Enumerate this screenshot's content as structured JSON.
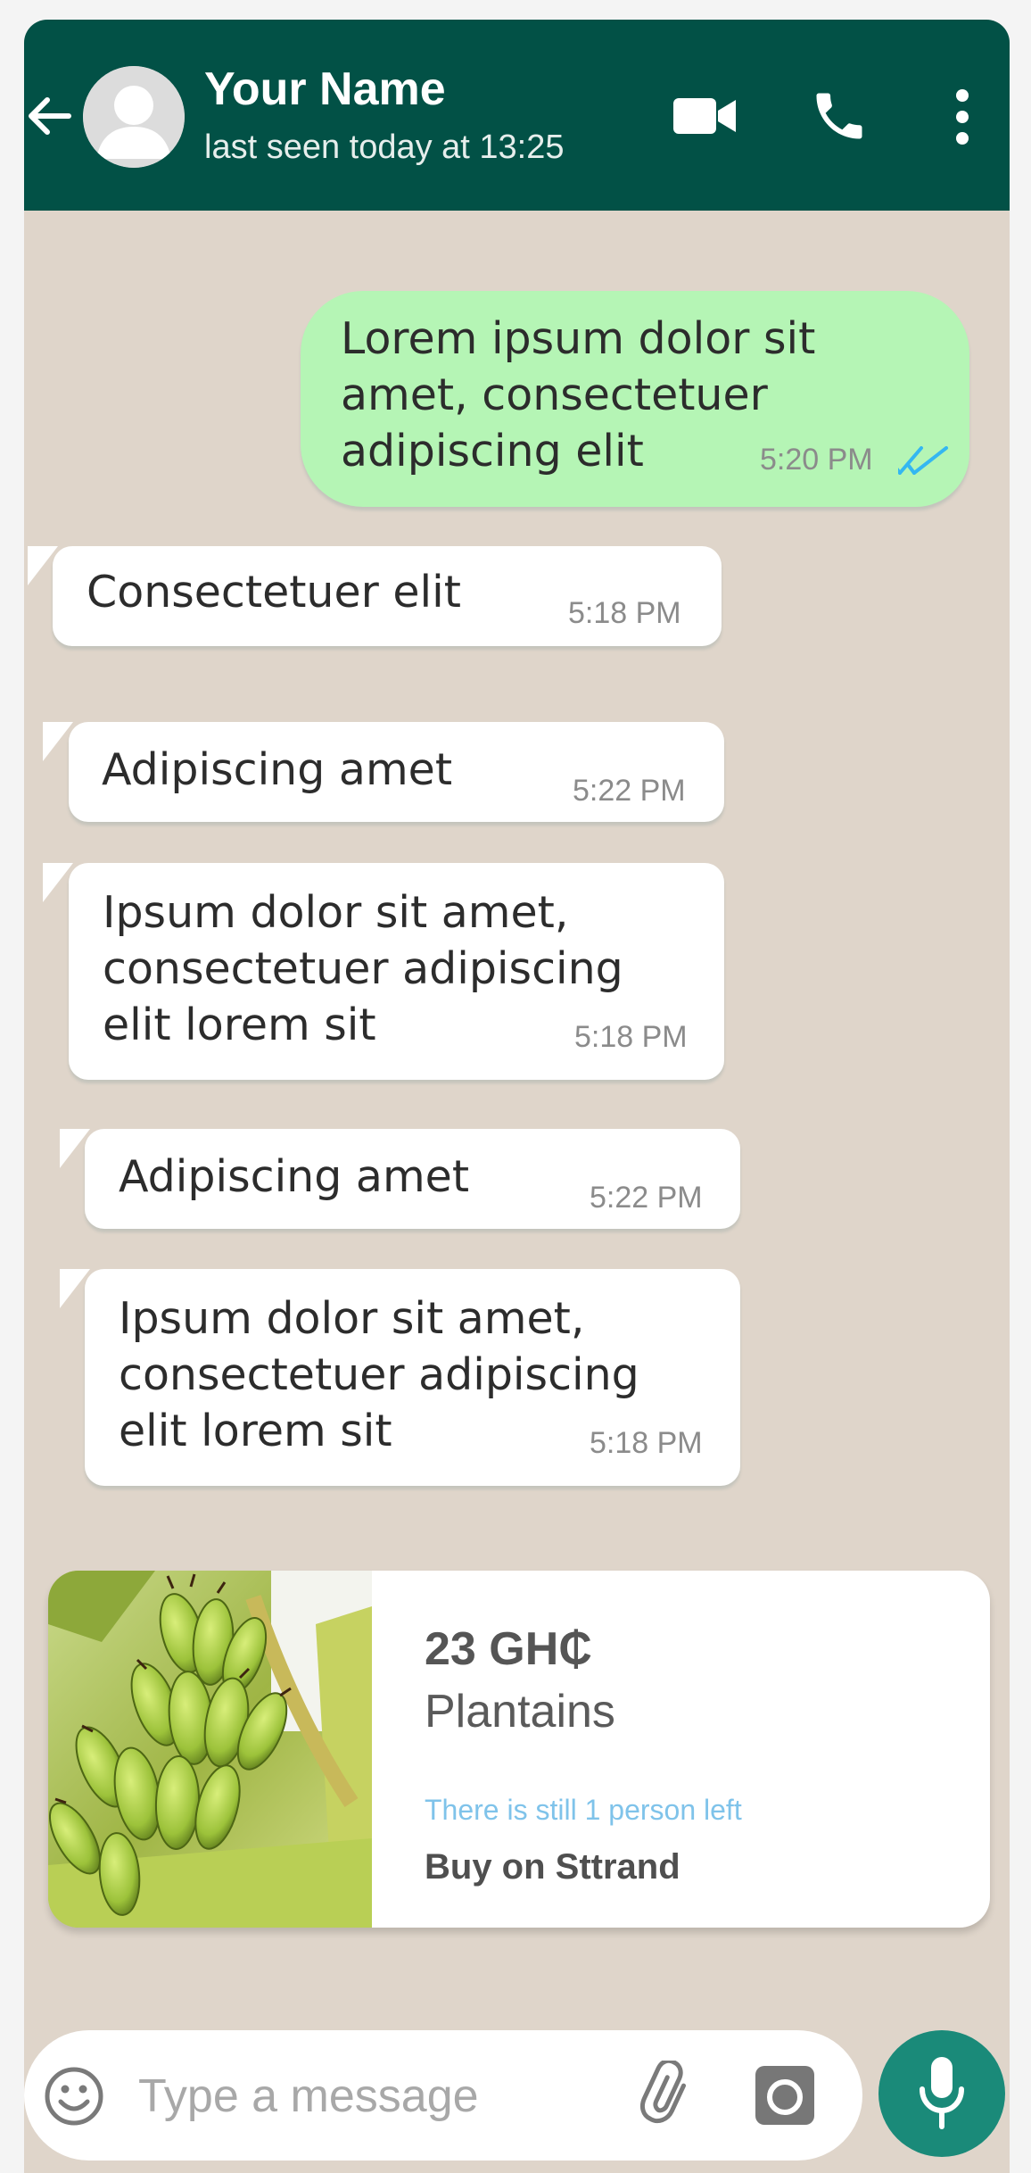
{
  "header": {
    "contact_name": "Your Name",
    "last_seen": "last seen today at 13:25",
    "icons": [
      "back-arrow-icon",
      "avatar-icon",
      "video-call-icon",
      "phone-icon",
      "more-vert-icon"
    ],
    "color": "#025146"
  },
  "messages": [
    {
      "direction": "outgoing",
      "lines": [
        "Lorem ipsum dolor sit",
        "amet, consectetuer",
        "adipiscing elit"
      ],
      "time": "5:20 PM",
      "status": "read"
    },
    {
      "direction": "incoming",
      "lines": [
        "Consectetuer elit"
      ],
      "time": "5:18 PM"
    },
    {
      "direction": "incoming",
      "lines": [
        "Adipiscing amet"
      ],
      "time": "5:22 PM"
    },
    {
      "direction": "incoming",
      "lines": [
        "Ipsum dolor sit amet,",
        "consectetuer adipiscing",
        "elit lorem sit"
      ],
      "time": "5:18 PM"
    },
    {
      "direction": "incoming",
      "lines": [
        "Adipiscing amet"
      ],
      "time": "5:22 PM"
    },
    {
      "direction": "incoming",
      "lines": [
        "Ipsum dolor sit amet,",
        "consectetuer adipiscing",
        "elit lorem sit"
      ],
      "time": "5:18 PM"
    }
  ],
  "product_card": {
    "price": "23 GH₵",
    "name": "Plantains",
    "availability": "There is still 1 person left",
    "buy_label": "Buy on Sttrand"
  },
  "input_bar": {
    "placeholder": "Type a message",
    "value": "",
    "icons": [
      "emoji-icon",
      "attach-icon",
      "camera-icon",
      "mic-icon"
    ]
  },
  "colors": {
    "chat_background": "#dfd5ca",
    "outgoing_bubble": "#b5f5b5",
    "incoming_bubble": "#ffffff",
    "read_receipt": "#34b7f1",
    "mic_button": "#1a8a79"
  }
}
